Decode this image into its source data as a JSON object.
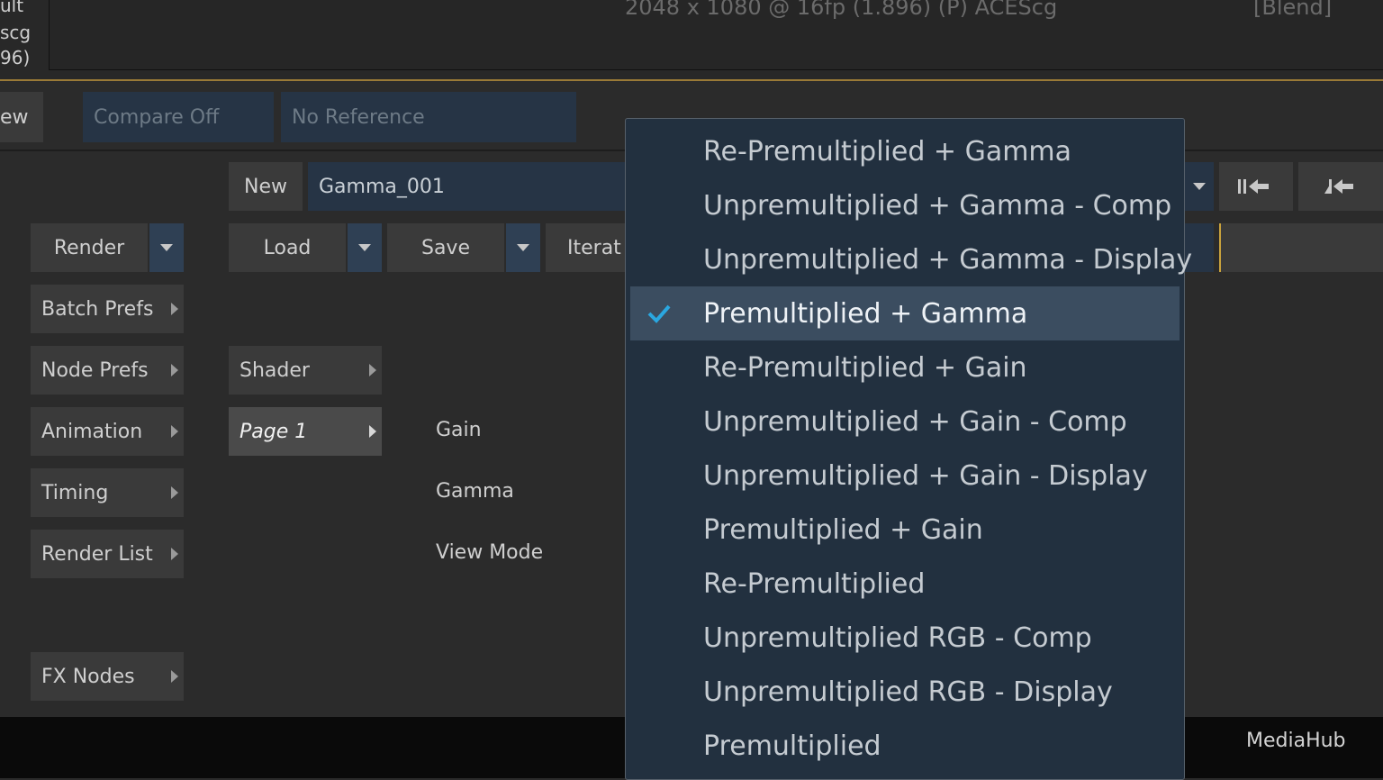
{
  "viewer": {
    "left_lines": [
      "ult",
      "scg",
      "96)"
    ],
    "resolution_info": "2048 x 1080 @ 16fp (1.896) (P) ACEScg",
    "blend_label": "[Blend]"
  },
  "row2": {
    "view_label": "ew",
    "compare": "Compare Off",
    "reference": "No Reference"
  },
  "toolbar": {
    "new_label": "New",
    "node_name": "Gamma_001",
    "iterate_label": "Iterat",
    "render_label": "Render",
    "load_label": "Load",
    "save_label": "Save"
  },
  "left_menu": {
    "batch_prefs": "Batch Prefs",
    "node_prefs": "Node Prefs",
    "animation": "Animation",
    "timing": "Timing",
    "render_list": "Render List",
    "fx_nodes": "FX Nodes"
  },
  "pages": {
    "shader": "Shader",
    "page1": "Page 1"
  },
  "params": {
    "gain": "Gain",
    "gamma": "Gamma",
    "view_mode": "View Mode"
  },
  "dropdown": {
    "items": [
      "Re-Premultiplied + Gamma",
      "Unpremultiplied + Gamma - Comp",
      "Unpremultiplied + Gamma - Display",
      "Premultiplied + Gamma",
      "Re-Premultiplied + Gain",
      "Unpremultiplied + Gain - Comp",
      "Unpremultiplied + Gain - Display",
      "Premultiplied + Gain",
      "Re-Premultiplied",
      "Unpremultiplied RGB - Comp",
      "Unpremultiplied RGB - Display",
      "Premultiplied"
    ],
    "selected": "Premultiplied + Gamma",
    "check_color": "#2aa7e0"
  },
  "footer": {
    "app_name": "MediaHub"
  },
  "colors": {
    "accent_gold": "#9a7a37",
    "menu_bg": "#22303f",
    "selected_bg": "#3b4d60"
  }
}
